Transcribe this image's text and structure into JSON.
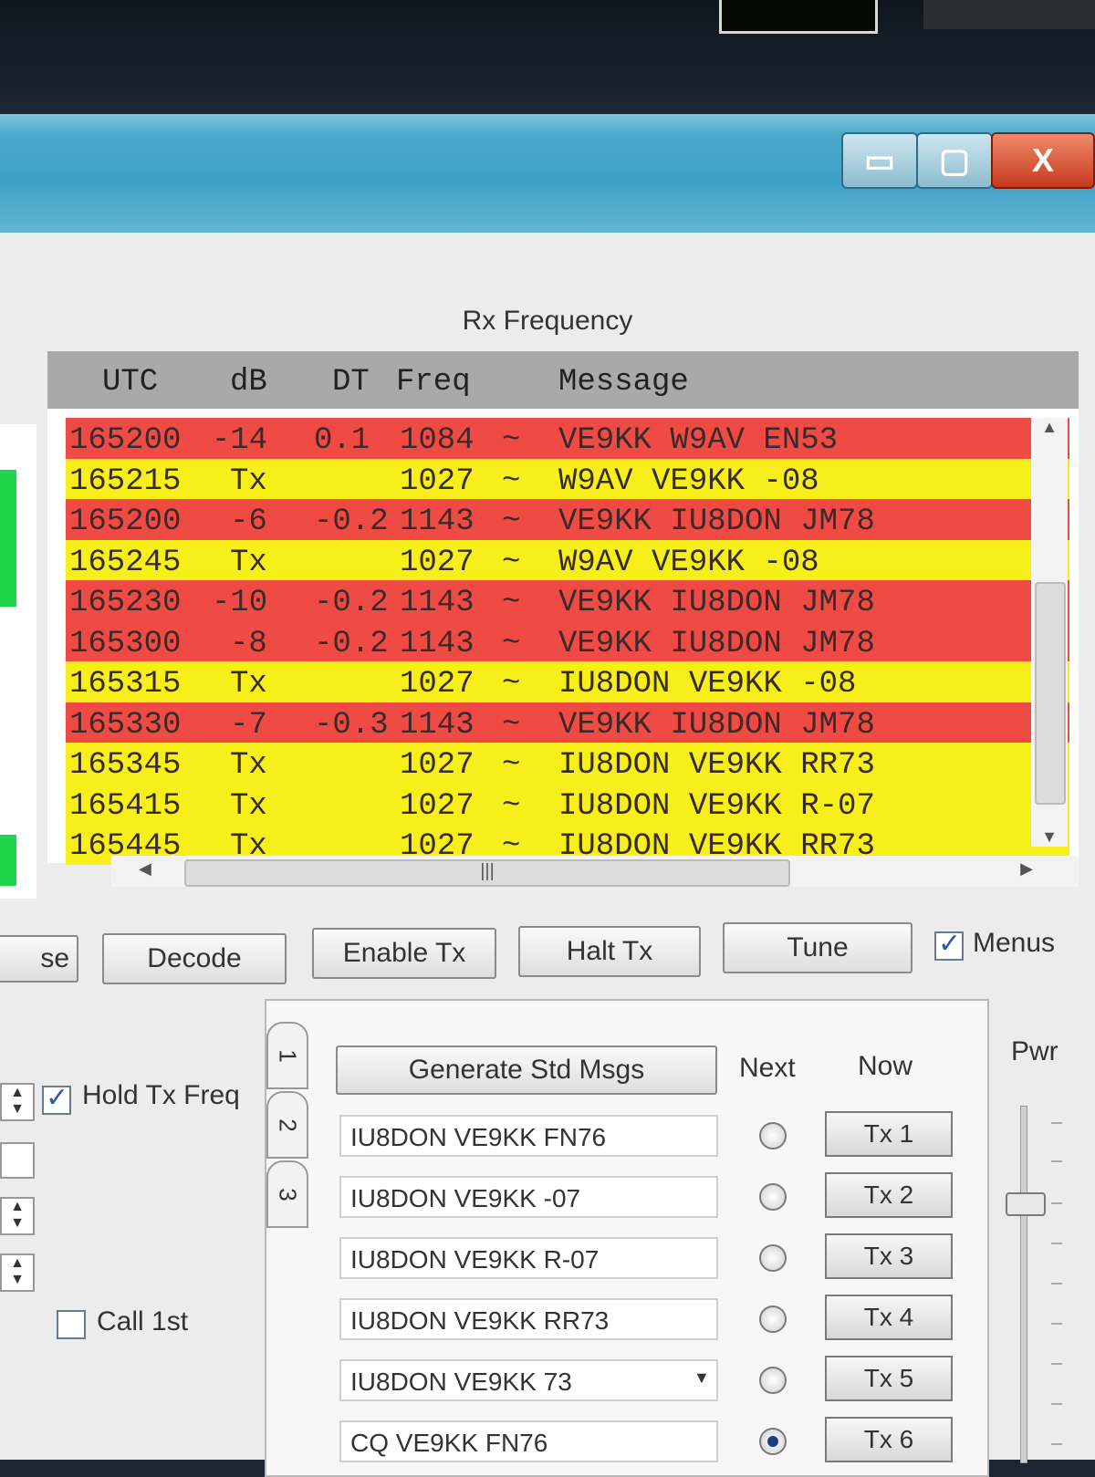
{
  "window": {
    "controls": {
      "minimize": "▭",
      "maximize": "▢",
      "close": "X"
    }
  },
  "rx_panel": {
    "caption": "Rx Frequency",
    "columns": {
      "utc": "UTC",
      "db": "dB",
      "dt": "DT",
      "freq": "Freq",
      "message": "Message"
    },
    "rows": [
      {
        "utc": "165200",
        "db": "-14",
        "dt": "0.1",
        "freq": "1084",
        "sep": "~",
        "message": "VE9KK W9AV EN53",
        "color": "#ef4a44"
      },
      {
        "utc": "165215",
        "db": "Tx",
        "dt": "",
        "freq": "1027",
        "sep": "~",
        "message": "W9AV VE9KK -08",
        "color": "#f6ef1a"
      },
      {
        "utc": "165200",
        "db": "-6",
        "dt": "-0.2",
        "freq": "1143",
        "sep": "~",
        "message": "VE9KK IU8DON JM78",
        "color": "#ef4a44"
      },
      {
        "utc": "165245",
        "db": "Tx",
        "dt": "",
        "freq": "1027",
        "sep": "~",
        "message": "W9AV VE9KK -08",
        "color": "#f6ef1a"
      },
      {
        "utc": "165230",
        "db": "-10",
        "dt": "-0.2",
        "freq": "1143",
        "sep": "~",
        "message": "VE9KK IU8DON JM78",
        "color": "#ef4a44"
      },
      {
        "utc": "165300",
        "db": "-8",
        "dt": "-0.2",
        "freq": "1143",
        "sep": "~",
        "message": "VE9KK IU8DON JM78",
        "color": "#ef4a44"
      },
      {
        "utc": "165315",
        "db": "Tx",
        "dt": "",
        "freq": "1027",
        "sep": "~",
        "message": "IU8DON VE9KK -08",
        "color": "#f6ef1a"
      },
      {
        "utc": "165330",
        "db": "-7",
        "dt": "-0.3",
        "freq": "1143",
        "sep": "~",
        "message": "VE9KK IU8DON JM78",
        "color": "#ef4a44"
      },
      {
        "utc": "165345",
        "db": "Tx",
        "dt": "",
        "freq": "1027",
        "sep": "~",
        "message": "IU8DON VE9KK RR73",
        "color": "#f6ef1a"
      },
      {
        "utc": "165415",
        "db": "Tx",
        "dt": "",
        "freq": "1027",
        "sep": "~",
        "message": "IU8DON VE9KK R-07",
        "color": "#f6ef1a"
      },
      {
        "utc": "165445",
        "db": "Tx",
        "dt": "",
        "freq": "1027",
        "sep": "~",
        "message": "IU8DON VE9KK RR73",
        "color": "#f6ef1a"
      }
    ]
  },
  "buttons": {
    "partial_left": "se",
    "decode": "Decode",
    "enable_tx": "Enable Tx",
    "halt_tx": "Halt Tx",
    "tune": "Tune",
    "menus": "Menus"
  },
  "left_controls": {
    "hold_tx_freq": "Hold Tx Freq",
    "call_1st": "Call 1st"
  },
  "tabs": [
    "1",
    "2",
    "3"
  ],
  "std_msgs": {
    "generate": "Generate Std Msgs",
    "next_label": "Next",
    "now_label": "Now",
    "pwr_label": "Pwr",
    "messages": [
      {
        "text": "IU8DON VE9KK FN76",
        "tx": "Tx 1",
        "selected": false
      },
      {
        "text": "IU8DON VE9KK -07",
        "tx": "Tx 2",
        "selected": false
      },
      {
        "text": "IU8DON VE9KK R-07",
        "tx": "Tx 3",
        "selected": false
      },
      {
        "text": "IU8DON VE9KK RR73",
        "tx": "Tx 4",
        "selected": false
      },
      {
        "text": "IU8DON VE9KK 73",
        "tx": "Tx 5",
        "selected": false
      },
      {
        "text": "CQ VE9KK FN76",
        "tx": "Tx 6",
        "selected": true
      }
    ]
  },
  "colors": {
    "decode_red": "#ef4a44",
    "tx_yellow": "#f6ef1a",
    "title_blue": "#3fa0c6"
  }
}
